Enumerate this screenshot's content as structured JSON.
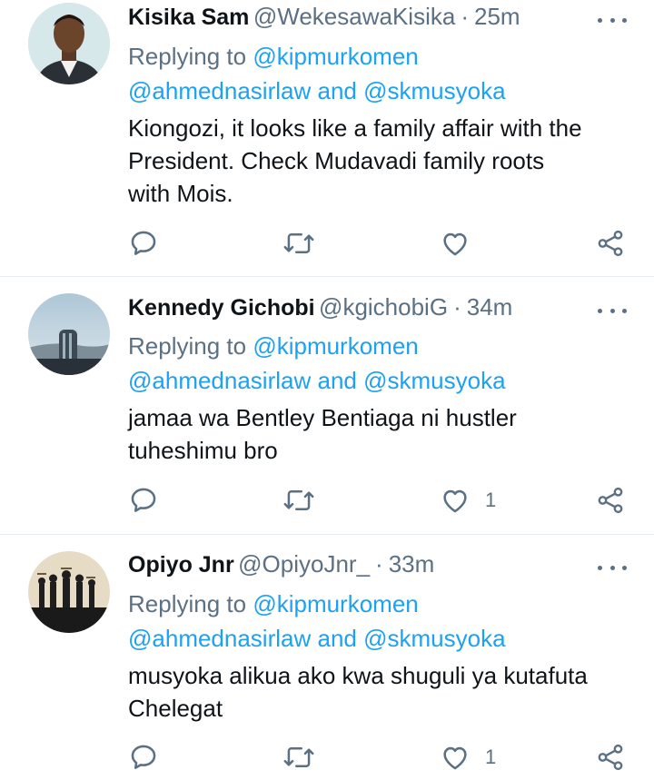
{
  "tweets": [
    {
      "name": "Kisika Sam",
      "handle": "@WekesawaKisika",
      "separator": "·",
      "time": "25m",
      "reply_prefix": "Replying to",
      "mention1": "@kipmurkomen",
      "mention2": "@ahmednasirlaw",
      "and_text": "and",
      "mention3": "@skmusyoka",
      "text_line1": "Kiongozi, it looks like a family affair with the",
      "text_line2": "President. Check Mudavadi family roots",
      "text_line3": "with Mois.",
      "likes": "",
      "avatar": "man-portrait-avatar"
    },
    {
      "name": "Kennedy Gichobi",
      "handle": "@kgichobiG",
      "separator": "·",
      "time": "34m",
      "reply_prefix": "Replying to",
      "mention1": "@kipmurkomen",
      "mention2": "@ahmednasirlaw",
      "and_text": "and",
      "mention3": "@skmusyoka",
      "text_line1": "jamaa wa Bentley Bentiaga ni hustler",
      "text_line2": "tuheshimu bro",
      "likes": "1",
      "avatar": "city-tower-avatar"
    },
    {
      "name": "Opiyo Jnr",
      "handle": "@OpiyoJnr_",
      "separator": "·",
      "time": "33m",
      "reply_prefix": "Replying to",
      "mention1": "@kipmurkomen",
      "mention2": "@ahmednasirlaw",
      "and_text": "and",
      "mention3": "@skmusyoka",
      "text_line1": "musyoka alikua ako kwa shuguli ya kutafuta",
      "text_line2": "Chelegat",
      "likes": "1",
      "avatar": "chess-pieces-avatar"
    }
  ],
  "colors": {
    "link": "#1da1f2",
    "secondary_text": "#5b7083",
    "primary_text": "#0f1419",
    "divider": "#e6ecf0"
  },
  "icons": [
    "reply-icon",
    "retweet-icon",
    "like-icon",
    "share-icon",
    "more-options-icon"
  ]
}
